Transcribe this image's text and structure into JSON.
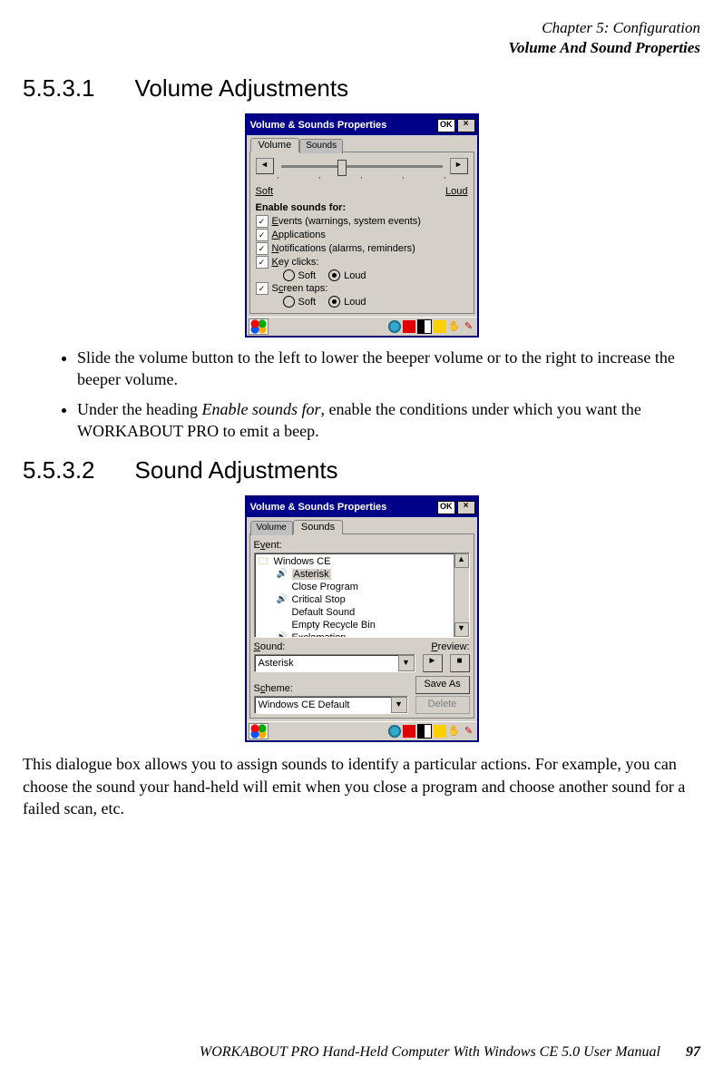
{
  "header": {
    "chapter": "Chapter 5: Configuration",
    "section": "Volume And Sound Properties"
  },
  "headings": {
    "h1_num": "5.5.3.1",
    "h1_title": "Volume Adjustments",
    "h2_num": "5.5.3.2",
    "h2_title": "Sound Adjustments"
  },
  "screenshot1": {
    "window_title": "Volume & Sounds Properties",
    "ok": "OK",
    "close": "×",
    "tabs": {
      "volume": "Volume",
      "sounds": "Sounds"
    },
    "slider": {
      "soft": "Soft",
      "loud": "Loud",
      "left_arrow": "◄",
      "right_arrow": "►"
    },
    "enable_heading": "Enable sounds for:",
    "checks": {
      "events": "Events (warnings, system events)",
      "apps": "Applications",
      "notif": "Notifications (alarms, reminders)",
      "keyclicks": "Key clicks:",
      "screentaps": "Screen taps:"
    },
    "radio": {
      "soft": "Soft",
      "loud": "Loud"
    }
  },
  "bullets": {
    "b1": "Slide the volume button to the left to lower the beeper volume or to the right to increase the beeper volume.",
    "b2a": "Under the heading ",
    "b2_em": "Enable sounds for",
    "b2b": ", enable the conditions under which you want the WORKABOUT PRO to emit a beep."
  },
  "screenshot2": {
    "window_title": "Volume & Sounds Properties",
    "ok": "OK",
    "close": "×",
    "tabs": {
      "volume": "Volume",
      "sounds": "Sounds"
    },
    "labels": {
      "event": "Event:",
      "sound": "Sound:",
      "preview": "Preview:",
      "scheme": "Scheme:"
    },
    "event_list": {
      "root": "Windows CE",
      "asterisk": "Asterisk",
      "close_program": "Close Program",
      "critical_stop": "Critical Stop",
      "default_sound": "Default Sound",
      "empty_bin": "Empty Recycle Bin",
      "exclamation": "Exclamation"
    },
    "sound_value": "Asterisk",
    "scheme_value": "Windows CE Default",
    "buttons": {
      "save_as": "Save As",
      "delete": "Delete"
    },
    "preview": {
      "play": "►",
      "stop": "■"
    },
    "scroll": {
      "up": "▲",
      "down": "▼"
    }
  },
  "para": "This dialogue box allows you to assign sounds to identify a particular actions. For example, you can choose the sound your hand-held will emit when you close a program and choose another sound for a failed scan, etc.",
  "footer": {
    "text": "WORKABOUT PRO Hand-Held Computer With Windows CE 5.0 User Manual",
    "page": "97"
  }
}
